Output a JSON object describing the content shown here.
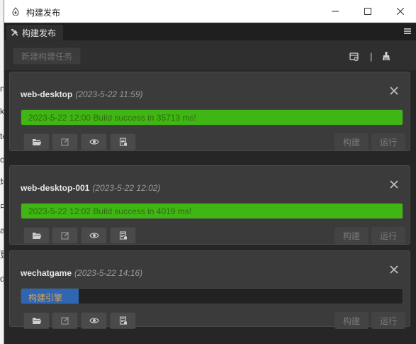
{
  "window": {
    "title": "构建发布",
    "tab_label": "构建发布"
  },
  "toolbar": {
    "new_task_label": "新建构建任务",
    "separator": "|"
  },
  "background_glyphs": [
    "n",
    "k",
    "to",
    "c",
    "地",
    "中",
    "a",
    "更",
    "d"
  ],
  "colors": {
    "success": "#3fb613",
    "success_text": "#2e6b12",
    "building": "#2f66b3",
    "building_text": "#e0a64b"
  },
  "tasks": [
    {
      "name": "web-desktop",
      "timestamp": "(2023-5-22 11:59)",
      "progress_text": "2023-5-22 12:00 Build success in 35713 ms!",
      "progress_percent": 100,
      "status": "success",
      "build_label": "构建",
      "run_label": "运行"
    },
    {
      "name": "web-desktop-001",
      "timestamp": "(2023-5-22 12:02)",
      "progress_text": "2023-5-22 12:02 Build success in 4019 ms!",
      "progress_percent": 100,
      "status": "success",
      "build_label": "构建",
      "run_label": "运行"
    },
    {
      "name": "wechatgame",
      "timestamp": "(2023-5-22 14:16)",
      "progress_text": "构建引擎",
      "progress_percent": 15,
      "status": "building",
      "build_label": "构建",
      "run_label": "运行"
    }
  ]
}
